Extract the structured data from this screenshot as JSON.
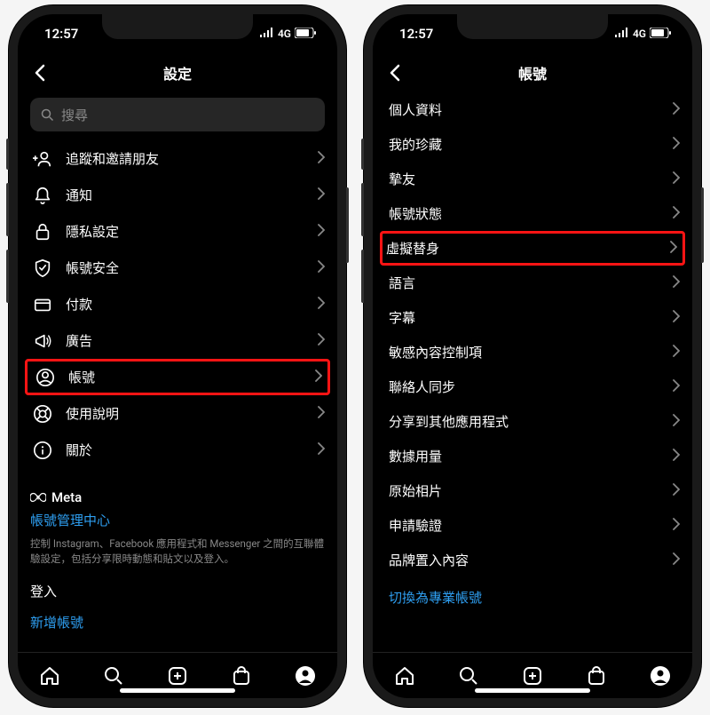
{
  "status": {
    "time": "12:57",
    "network": "4G"
  },
  "left": {
    "title": "設定",
    "search_placeholder": "搜尋",
    "items": [
      {
        "icon": "add-friend-icon",
        "label": "追蹤和邀請朋友"
      },
      {
        "icon": "bell-icon",
        "label": "通知"
      },
      {
        "icon": "lock-icon",
        "label": "隱私設定"
      },
      {
        "icon": "shield-icon",
        "label": "帳號安全"
      },
      {
        "icon": "card-icon",
        "label": "付款"
      },
      {
        "icon": "megaphone-icon",
        "label": "廣告"
      },
      {
        "icon": "account-icon",
        "label": "帳號",
        "highlight": true
      },
      {
        "icon": "lifebuoy-icon",
        "label": "使用說明"
      },
      {
        "icon": "info-icon",
        "label": "關於"
      }
    ],
    "meta_label": "Meta",
    "accounts_center": "帳號管理中心",
    "accounts_center_help": "控制 Instagram、Facebook 應用程式和 Messenger 之間的互聯體驗設定，包括分享限時動態和貼文以及登入。",
    "login_label": "登入",
    "add_account": "新增帳號"
  },
  "right": {
    "title": "帳號",
    "items": [
      {
        "label": "個人資料"
      },
      {
        "label": "我的珍藏"
      },
      {
        "label": "摯友"
      },
      {
        "label": "帳號狀態"
      },
      {
        "label": "虛擬替身",
        "highlight": true
      },
      {
        "label": "語言"
      },
      {
        "label": "字幕"
      },
      {
        "label": "敏感內容控制項"
      },
      {
        "label": "聯絡人同步"
      },
      {
        "label": "分享到其他應用程式"
      },
      {
        "label": "數據用量"
      },
      {
        "label": "原始相片"
      },
      {
        "label": "申請驗證"
      },
      {
        "label": "品牌置入內容"
      }
    ],
    "switch_pro": "切換為專業帳號"
  }
}
